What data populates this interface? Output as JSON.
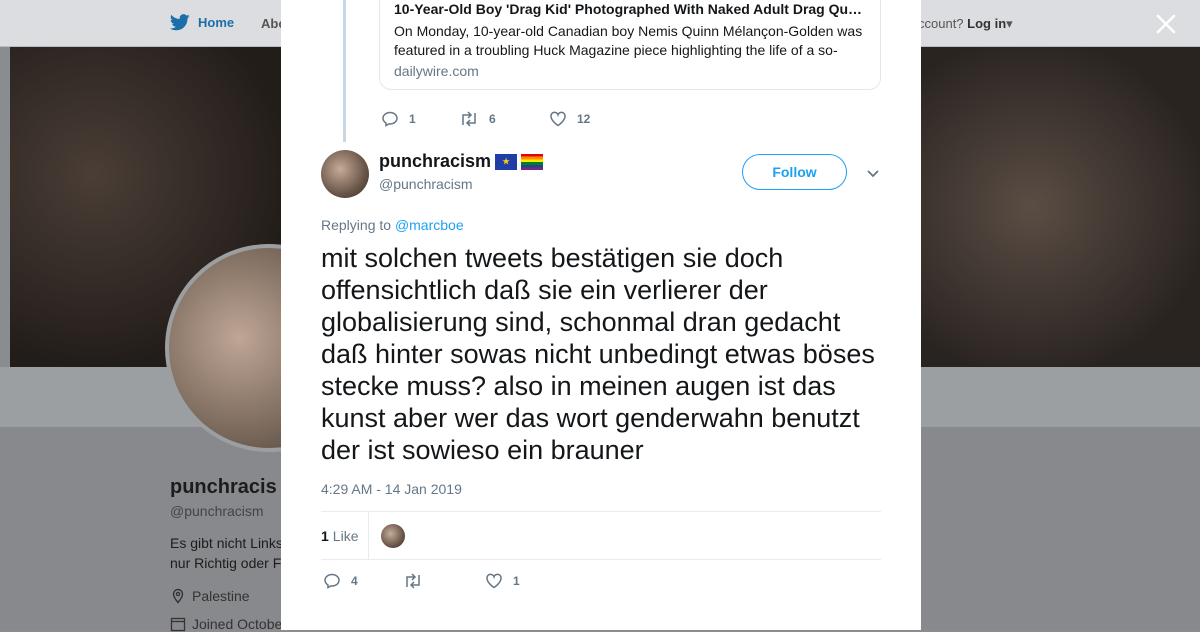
{
  "nav": {
    "home_label": "Home",
    "about_label": "Abo",
    "account_prompt": "ccount?",
    "login_label": "Log in"
  },
  "profile": {
    "name": "punchracis",
    "handle": "@punchracism",
    "bio_line1": "Es gibt nicht Links",
    "bio_line2": "nur Richtig oder F",
    "location": "Palestine",
    "joined": "Joined Octobe"
  },
  "parent_tweet": {
    "card": {
      "title": "10-Year-Old Boy 'Drag Kid' Photographed With Naked Adult Drag Qu…",
      "description": "On Monday, 10-year-old Canadian boy Nemis Quinn Mélançon-Golden was featured in a troubling Huck Magazine piece highlighting the life of a so-",
      "domain": "dailywire.com"
    },
    "replies": "1",
    "retweets": "6",
    "likes": "12"
  },
  "tweet": {
    "author_name": "punchracism",
    "flags": [
      "eu-flag",
      "rainbow-flag"
    ],
    "author_handle": "@punchracism",
    "follow_label": "Follow",
    "replying_prefix": "Replying to",
    "replying_to": "@marcboe",
    "text": "mit solchen tweets bestätigen sie doch offensichtlich daß sie ein verlierer der globalisierung sind, schonmal dran gedacht daß hinter sowas nicht unbedingt etwas böses stecke muss? also in meinen augen ist das kunst aber wer das wort genderwahn benutzt der ist sowieso ein brauner",
    "timestamp": "4:29 AM - 14 Jan 2019",
    "like_count": "1",
    "like_label": "Like",
    "replies": "4",
    "retweets": "",
    "likes": "1"
  },
  "colors": {
    "accent": "#1da1f2",
    "text": "#14171a",
    "muted": "#657786"
  }
}
